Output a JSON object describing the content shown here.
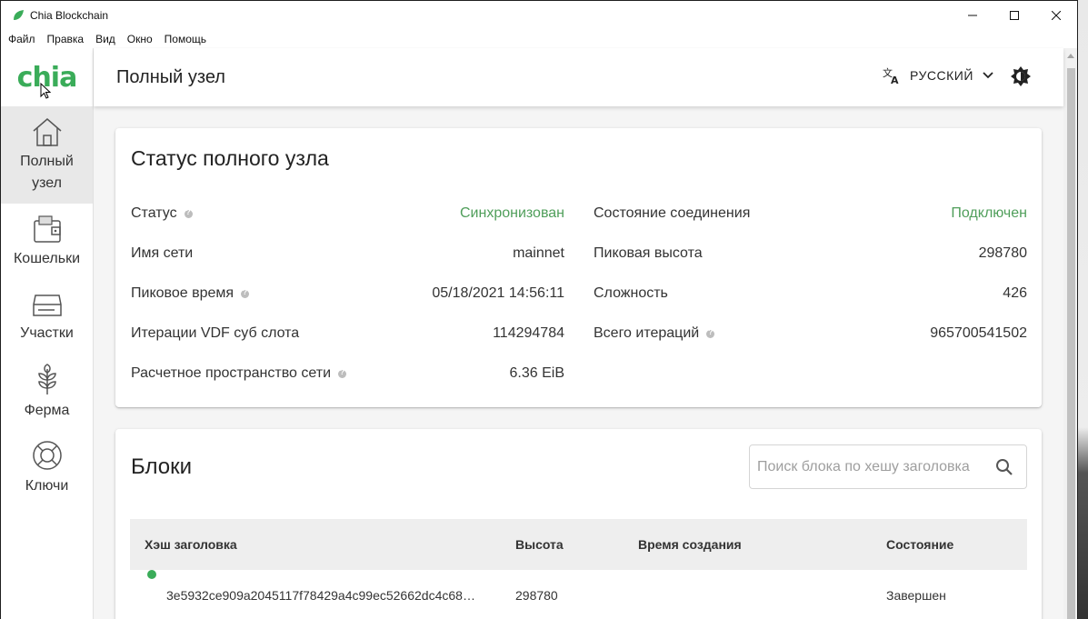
{
  "window": {
    "title": "Chia Blockchain"
  },
  "menu": [
    "Файл",
    "Правка",
    "Вид",
    "Окно",
    "Помощь"
  ],
  "logo": {
    "text": "chia"
  },
  "sidebar": {
    "items": [
      {
        "label": "Полный узел",
        "icon": "home-icon",
        "active": true
      },
      {
        "label": "Кошельки",
        "icon": "wallet-icon",
        "active": false
      },
      {
        "label": "Участки",
        "icon": "drive-icon",
        "active": false
      },
      {
        "label": "Ферма",
        "icon": "farm-icon",
        "active": false
      },
      {
        "label": "Ключи",
        "icon": "lifebuoy-icon",
        "active": false
      }
    ]
  },
  "header": {
    "title": "Полный узел",
    "language": "РУССКИЙ",
    "theme_icon": "brightness-icon"
  },
  "status_card": {
    "title": "Статус полного узла",
    "left": [
      {
        "label": "Статус",
        "value": "Синхронизован",
        "help": true,
        "status": true
      },
      {
        "label": "Имя сети",
        "value": "mainnet",
        "help": false
      },
      {
        "label": "Пиковое время",
        "value": "05/18/2021 14:56:11",
        "help": true
      },
      {
        "label": "Итерации VDF суб слота",
        "value": "114294784",
        "help": false
      },
      {
        "label": "Расчетное пространство сети",
        "value": "6.36 EiB",
        "help": true
      }
    ],
    "right": [
      {
        "label": "Состояние соединения",
        "value": "Подключен",
        "help": false,
        "status": true
      },
      {
        "label": "Пиковая высота",
        "value": "298780",
        "help": false
      },
      {
        "label": "Сложность",
        "value": "426",
        "help": false
      },
      {
        "label": "Всего итераций",
        "value": "965700541502",
        "help": true
      }
    ]
  },
  "blocks_card": {
    "title": "Блоки",
    "search_placeholder": "Поиск блока по хешу заголовка",
    "columns": [
      "Хэш заголовка",
      "Высота",
      "Время создания",
      "Состояние"
    ],
    "rows": [
      {
        "hash": "3e5932ce909a2045117f78429a4c99ec52662dc4c68…",
        "height": "298780",
        "time": "",
        "state": "Завершен"
      }
    ]
  },
  "colors": {
    "accent": "#3aac59",
    "status_green": "#4f9e5a"
  }
}
